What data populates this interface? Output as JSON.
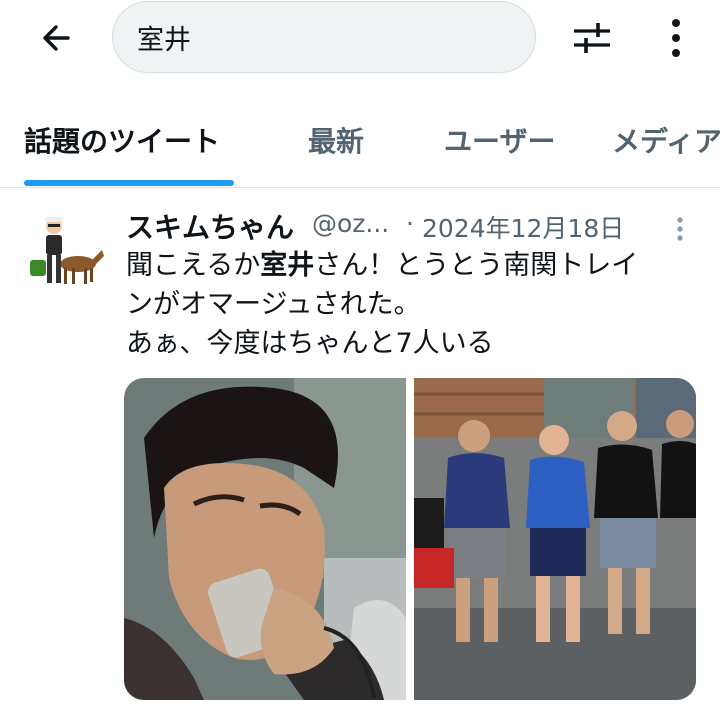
{
  "search": {
    "query": "室井"
  },
  "tabs": [
    {
      "label": "話題のツイート",
      "active": true
    },
    {
      "label": "最新",
      "active": false
    },
    {
      "label": "ユーザー",
      "active": false
    },
    {
      "label": "メディア",
      "active": false
    }
  ],
  "tweet": {
    "author_name": "スキムちゃん",
    "author_handle": "@oz...",
    "separator": "·",
    "date": "2024年12月18日",
    "text_line1_pre": "聞こえるか",
    "text_line1_highlight": "室井",
    "text_line1_post": "さん！とうとう南関トレイ",
    "text_line2": "ンがオマージュされた。",
    "text_line3": "あぁ、今度はちゃんと7人いる"
  },
  "icons": {
    "back": "arrow-left-icon",
    "filter": "filter-sliders-icon",
    "more": "more-vertical-icon",
    "tweet_more": "more-vertical-icon"
  },
  "colors": {
    "accent": "#1d9bf0",
    "text_primary": "#0f1419",
    "text_secondary": "#536471",
    "search_bg": "#eff3f4"
  }
}
